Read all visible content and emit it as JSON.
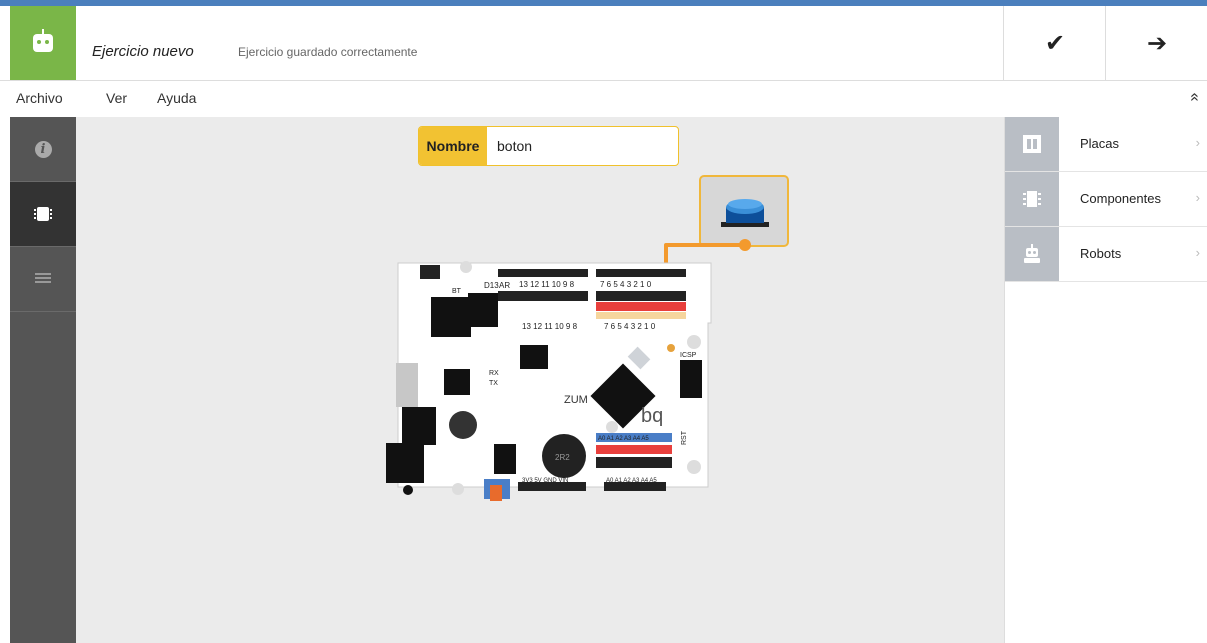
{
  "header": {
    "title": "Ejercicio nuevo",
    "status": "Ejercicio guardado correctamente",
    "check_icon": "✔",
    "next_icon": "➔"
  },
  "menu": {
    "items": [
      "Archivo",
      "Ver",
      "Ayuda"
    ],
    "collapse_icon": "»"
  },
  "workspace": {
    "name_label": "Nombre",
    "name_value": "boton",
    "board": {
      "pin_numbers_top": "13 12 11 10 9 8",
      "pin_numbers_top2": "7 6 5 4 3 2 1 0",
      "label_zum": "ZUM",
      "label_bq": "bq",
      "label_d13": "D13",
      "label_ar": "AR",
      "label_bt": "BT",
      "label_rx": "RX",
      "label_tx": "TX",
      "label_icsp": "ICSP",
      "label_rst": "RST",
      "label_analog": "A0 A1 A2 A3 A4 A5",
      "label_power": "3V3 5V GND VIN",
      "label_analog_bottom": "A0 A1 A2 A3 A4 A5",
      "label_2r2": "2R2"
    }
  },
  "right_panel": {
    "items": [
      {
        "label": "Placas",
        "icon": "board-icon"
      },
      {
        "label": "Componentes",
        "icon": "chip-icon"
      },
      {
        "label": "Robots",
        "icon": "robot-icon"
      }
    ],
    "chevron": "›"
  },
  "colors": {
    "brand_green": "#7ab648",
    "accent_yellow": "#f2c232",
    "wire_orange": "#f39a2d",
    "sidebar_dark": "#555555"
  }
}
